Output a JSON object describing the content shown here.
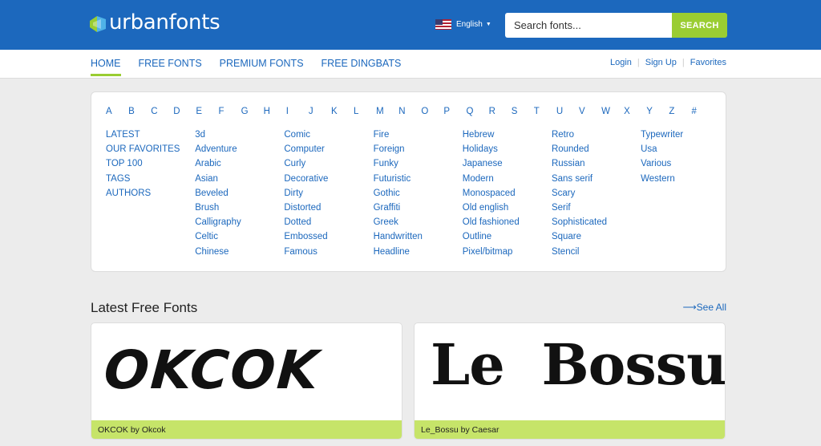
{
  "header": {
    "logo_text": "urbanfonts",
    "language": "English",
    "search": {
      "placeholder": "Search fonts...",
      "button_label": "SEARCH"
    }
  },
  "nav": {
    "main": [
      "HOME",
      "FREE FONTS",
      "PREMIUM FONTS",
      "FREE DINGBATS"
    ],
    "active": "HOME",
    "right": [
      "Login",
      "Sign Up",
      "Favorites"
    ]
  },
  "alphabet": [
    "A",
    "B",
    "C",
    "D",
    "E",
    "F",
    "G",
    "H",
    "I",
    "J",
    "K",
    "L",
    "M",
    "N",
    "O",
    "P",
    "Q",
    "R",
    "S",
    "T",
    "U",
    "V",
    "W",
    "X",
    "Y",
    "Z",
    "#"
  ],
  "category_columns": [
    [
      "LATEST",
      "OUR FAVORITES",
      "TOP 100",
      "TAGS",
      "AUTHORS"
    ],
    [
      "3d",
      "Adventure",
      "Arabic",
      "Asian",
      "Beveled",
      "Brush",
      "Calligraphy",
      "Celtic",
      "Chinese"
    ],
    [
      "Comic",
      "Computer",
      "Curly",
      "Decorative",
      "Dirty",
      "Distorted",
      "Dotted",
      "Embossed",
      "Famous"
    ],
    [
      "Fire",
      "Foreign",
      "Funky",
      "Futuristic",
      "Gothic",
      "Graffiti",
      "Greek",
      "Handwritten",
      "Headline"
    ],
    [
      "Hebrew",
      "Holidays",
      "Japanese",
      "Modern",
      "Monospaced",
      "Old english",
      "Old fashioned",
      "Outline",
      "Pixel/bitmap"
    ],
    [
      "Retro",
      "Rounded",
      "Russian",
      "Sans serif",
      "Scary",
      "Serif",
      "Sophisticated",
      "Square",
      "Stencil"
    ],
    [
      "Typewriter",
      "Usa",
      "Various",
      "Western"
    ]
  ],
  "latest": {
    "title": "Latest Free Fonts",
    "see_all": "See All",
    "cards": [
      {
        "preview": "OKCOK",
        "caption": "OKCOK by Okcok"
      },
      {
        "preview": "Le  Bossu",
        "caption": "Le_Bossu by Caesar"
      }
    ]
  },
  "colors": {
    "brand_blue": "#1c68bd",
    "accent_green": "#9acd32",
    "caption_green": "#c6e469"
  }
}
